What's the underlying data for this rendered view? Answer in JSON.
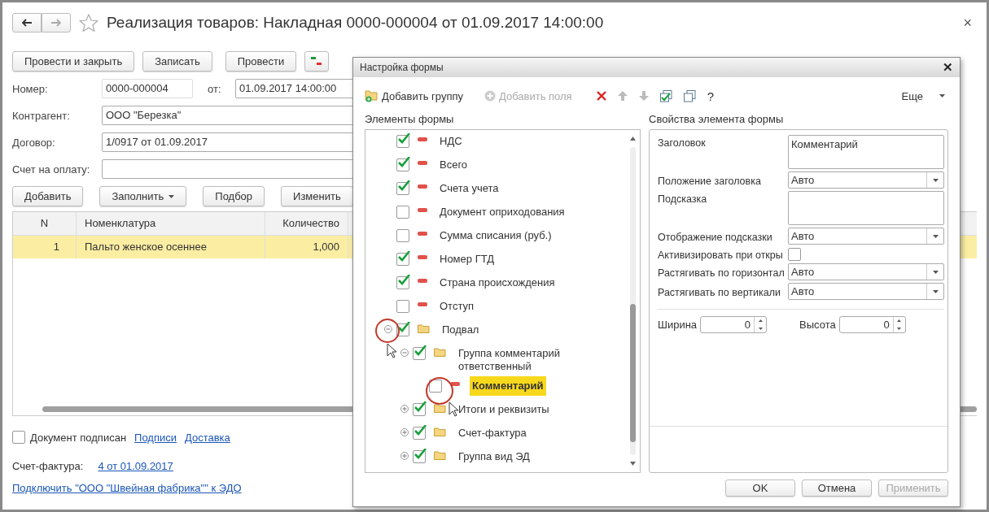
{
  "window": {
    "title": "Реализация товаров: Накладная 0000-000004 от 01.09.2017 14:00:00",
    "close": "×"
  },
  "toolbar": {
    "buttons": [
      "Провести и закрыть",
      "Записать",
      "Провести"
    ]
  },
  "header": {
    "number": {
      "label": "Номер:",
      "value": "0000-000004"
    },
    "date": {
      "label": "от:",
      "value": "01.09.2017 14:00:00"
    },
    "fields": [
      {
        "label": "Контрагент:",
        "value": "ООО \"Березка\""
      },
      {
        "label": "Договор:",
        "value": "1/0917 от 01.09.2017"
      },
      {
        "label": "Счет на оплату:"
      }
    ]
  },
  "table_toolbar": [
    {
      "label": "Добавить",
      "kind": "plain"
    },
    {
      "label": "Заполнить",
      "kind": "menu"
    },
    {
      "label": "Подбор",
      "kind": "plain"
    },
    {
      "label": "Изменить",
      "kind": "plain"
    }
  ],
  "table": {
    "columns": [
      "N",
      "Номенклатура",
      "Количество"
    ],
    "rows": [
      {
        "cells": [
          "1",
          "Пальто женское осеннее",
          "1,000"
        ],
        "selected": true
      }
    ]
  },
  "footer": {
    "signed": {
      "label": "Документ подписан",
      "checked": false
    },
    "links": [
      "Подписи",
      "Доставка"
    ],
    "invoice": {
      "label": "Счет-фактура:",
      "link": "4 от 01.09.2017"
    },
    "edo_link": "Подключить \"ООО \"Швейная фабрика\"\" к ЭДО"
  },
  "dialog": {
    "title": "Настройка формы",
    "close": "✕",
    "toolbar": {
      "add_group": "Добавить группу",
      "add_fields": {
        "label": "Добавить поля",
        "disabled": true
      },
      "help": "?",
      "more": "Еще"
    },
    "tree_title": "Элементы формы",
    "props_title": "Свойства элемента формы",
    "tree": [
      {
        "label": "НДС",
        "kind": "field",
        "checked": true,
        "selected": false
      },
      {
        "label": "Всего",
        "kind": "field",
        "checked": true,
        "selected": false
      },
      {
        "label": "Счета учета",
        "kind": "field",
        "checked": true,
        "selected": false
      },
      {
        "label": "Документ оприходования",
        "kind": "field",
        "checked": false,
        "selected": false
      },
      {
        "label": "Сумма списания (руб.)",
        "kind": "field",
        "checked": false,
        "selected": false
      },
      {
        "label": "Номер ГТД",
        "kind": "field",
        "checked": true,
        "selected": false
      },
      {
        "label": "Страна происхождения",
        "kind": "field",
        "checked": true,
        "selected": false
      },
      {
        "label": "Отступ",
        "kind": "field",
        "checked": false,
        "selected": false
      },
      {
        "label": "Подвал",
        "kind": "group",
        "checked": true,
        "selected": false,
        "expanded": true,
        "children": [
          {
            "label": "Группа комментарий ответственный",
            "kind": "group",
            "checked": true,
            "selected": false,
            "expanded": true,
            "children": [
              {
                "label": "Комментарий",
                "kind": "field",
                "checked": false,
                "selected": true
              }
            ]
          },
          {
            "label": "Итоги и реквизиты",
            "kind": "group",
            "checked": true,
            "selected": false,
            "expanded": false
          },
          {
            "label": "Счет-фактура",
            "kind": "group",
            "checked": true,
            "selected": false,
            "expanded": false
          },
          {
            "label": "Группа вид ЭД",
            "kind": "group",
            "checked": true,
            "selected": false,
            "expanded": false
          }
        ]
      }
    ],
    "properties": [
      {
        "kind": "textarea",
        "label": "Заголовок",
        "value": "Комментарий"
      },
      {
        "kind": "select",
        "label": "Положение заголовка",
        "value": "Авто"
      },
      {
        "kind": "textarea",
        "label": "Подсказка"
      },
      {
        "kind": "select",
        "label": "Отображение подсказки",
        "value": "Авто"
      },
      {
        "kind": "checkbox",
        "label": "Активизировать при откры",
        "checked": false
      },
      {
        "kind": "select",
        "label": "Растягивать по горизонтал",
        "value": "Авто"
      },
      {
        "kind": "select",
        "label": "Растягивать по вертикали",
        "value": "Авто"
      }
    ],
    "size": [
      {
        "label": "Ширина",
        "value": "0"
      },
      {
        "label": "Высота",
        "value": "0"
      }
    ],
    "buttons": [
      {
        "label": "OK",
        "disabled": false
      },
      {
        "label": "Отмена",
        "disabled": false
      },
      {
        "label": "Применить",
        "disabled": true
      }
    ]
  }
}
